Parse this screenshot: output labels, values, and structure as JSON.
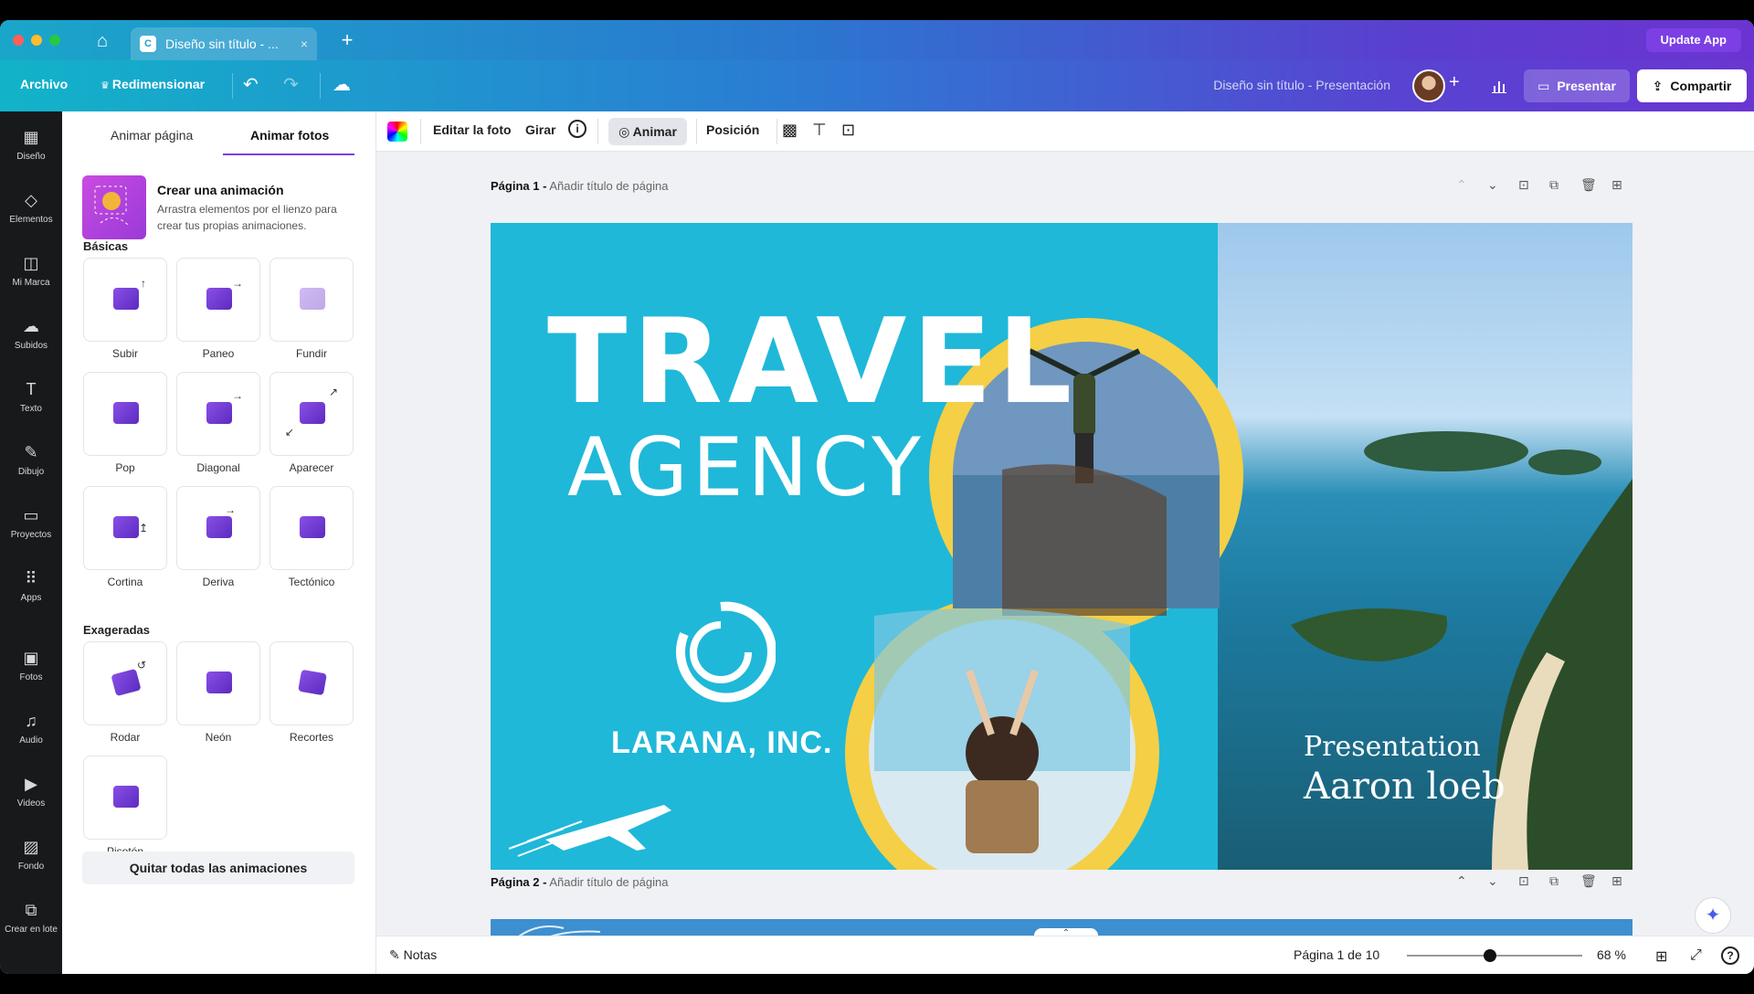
{
  "window": {
    "tab_title": "Diseño sin título - ...",
    "tab_close": "×",
    "new_tab": "+",
    "update_app": "Update App"
  },
  "toolbar": {
    "archivo": "Archivo",
    "redimensionar": "Redimensionar",
    "doc_title": "Diseño sin título - Presentación",
    "plus": "+",
    "presentar": "Presentar",
    "compartir": "Compartir"
  },
  "rail": [
    {
      "label": "Diseño",
      "icon": "layout-icon",
      "glyph": "▦"
    },
    {
      "label": "Elementos",
      "icon": "shapes-icon",
      "glyph": "◇"
    },
    {
      "label": "Mi Marca",
      "icon": "brand-icon",
      "glyph": "◫"
    },
    {
      "label": "Subidos",
      "icon": "upload-cloud-icon",
      "glyph": "☁"
    },
    {
      "label": "Texto",
      "icon": "text-icon",
      "glyph": "T"
    },
    {
      "label": "Dibujo",
      "icon": "draw-icon",
      "glyph": "✎"
    },
    {
      "label": "Proyectos",
      "icon": "folder-icon",
      "glyph": "▭"
    },
    {
      "label": "Apps",
      "icon": "apps-grid-icon",
      "glyph": "⠿"
    },
    {
      "label": "Fotos",
      "icon": "photos-icon",
      "glyph": "▣"
    },
    {
      "label": "Audio",
      "icon": "music-note-icon",
      "glyph": "♫"
    },
    {
      "label": "Videos",
      "icon": "video-icon",
      "glyph": "▶"
    },
    {
      "label": "Fondo",
      "icon": "pattern-icon",
      "glyph": "▨"
    },
    {
      "label": "Crear en lote",
      "icon": "batch-create-icon",
      "glyph": "⧉"
    }
  ],
  "panel": {
    "tab_pagina": "Animar página",
    "tab_fotos": "Animar fotos",
    "crear_title": "Crear una animación",
    "crear_desc": "Arrastra elementos por el lienzo para crear tus propias animaciones.",
    "basicas": "Básicas",
    "exageradas": "Exageradas",
    "basicas_items": [
      "Subir",
      "Paneo",
      "Fundir",
      "Pop",
      "Diagonal",
      "Aparecer",
      "Cortina",
      "Deriva",
      "Tectónico"
    ],
    "exageradas_items": [
      "Rodar",
      "Neón",
      "Recortes",
      "Pisotón"
    ],
    "remove_all": "Quitar todas las animaciones"
  },
  "context": {
    "editar": "Editar la foto",
    "girar": "Girar",
    "animar": "Animar",
    "posicion": "Posición"
  },
  "pages": {
    "p1_label": "Página 1 -",
    "p1_sub": "Añadir título de página",
    "p2_label": "Página 2 -",
    "p2_sub": "Añadir título de página"
  },
  "slide": {
    "title": "TRAVEL",
    "subtitle": "AGENCY",
    "company": "LARANA, INC.",
    "pres": "Presentation",
    "name": "Aaron loeb",
    "bg_color": "#1fb8d9",
    "ring_color": "#f5cf45"
  },
  "bottom": {
    "notas": "Notas",
    "page_count": "Página 1 de 10",
    "zoom": "68 %",
    "zoom_level": 0.68
  }
}
